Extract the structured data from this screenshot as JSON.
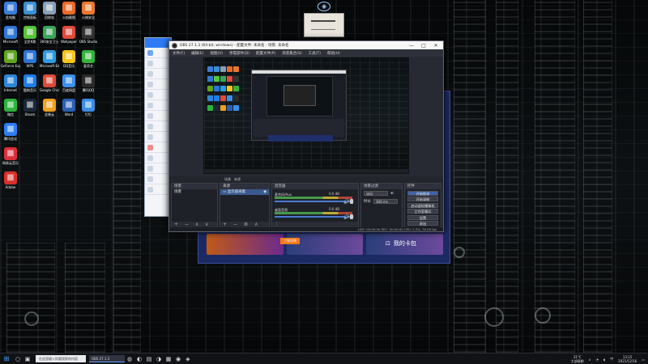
{
  "desktop": {
    "icons": [
      {
        "label": "此电脑",
        "icon": "pc-icon",
        "color": "#3b7dd8"
      },
      {
        "label": "控制面板",
        "icon": "control-panel-icon",
        "color": "#3a8fd4"
      },
      {
        "label": "回收站",
        "icon": "recycle-bin-icon",
        "color": "#8aa0b8"
      },
      {
        "label": "火焰截图",
        "icon": "flame-icon",
        "color": "#e86a2a"
      },
      {
        "label": "火绒安全",
        "icon": "shield-icon",
        "color": "#e9782e"
      },
      {
        "label": "Microsoft",
        "icon": "microsoft-icon",
        "color": "#2f78d6"
      },
      {
        "label": "全民K歌",
        "icon": "music-icon",
        "color": "#57c43b"
      },
      {
        "label": "360安全卫士",
        "icon": "security-icon",
        "color": "#3ba55c"
      },
      {
        "label": "Wallpaper",
        "icon": "wallpaper-icon",
        "color": "#e04a3a"
      },
      {
        "label": "OBS Studio",
        "icon": "obs-icon",
        "color": "#333333"
      },
      {
        "label": "GeForce Experience",
        "icon": "nvidia-icon",
        "color": "#62a51d"
      },
      {
        "label": "WPS",
        "icon": "wps-icon",
        "color": "#2c75d8"
      },
      {
        "label": "Microsoft Edge",
        "icon": "edge-icon",
        "color": "#2d9be0"
      },
      {
        "label": "QQ音乐",
        "icon": "qqmusic-icon",
        "color": "#f5c518"
      },
      {
        "label": "爱奇艺",
        "icon": "iqiyi-icon",
        "color": "#33b33d"
      },
      {
        "label": "Internet",
        "icon": "ie-icon",
        "color": "#2b86d6"
      },
      {
        "label": "酷狗音乐",
        "icon": "kugou-icon",
        "color": "#1d7de6"
      },
      {
        "label": "Google Chrome",
        "icon": "chrome-icon",
        "color": "#dd4a3a"
      },
      {
        "label": "百度网盘",
        "icon": "cloud-icon",
        "color": "#3a8fe8"
      },
      {
        "label": "腾讯QQ",
        "icon": "qq-icon",
        "color": "#2a2a2a"
      },
      {
        "label": "微信",
        "icon": "wechat-icon",
        "color": "#2cb43a"
      },
      {
        "label": "Steam",
        "icon": "steam-icon",
        "color": "#1b2838"
      },
      {
        "label": "坚果云",
        "icon": "nut-icon",
        "color": "#f0a020"
      },
      {
        "label": "Word",
        "icon": "word-icon",
        "color": "#2b5fb4"
      },
      {
        "label": "钉钉",
        "icon": "dingtalk-icon",
        "color": "#3a8ee6"
      },
      {
        "label": "腾讯会议",
        "icon": "meeting-icon",
        "color": "#2d7df0"
      },
      {
        "label": "网易云音乐",
        "icon": "netease-icon",
        "color": "#d9303a"
      },
      {
        "label": "Adobe",
        "icon": "adobe-icon",
        "color": "#d8302a"
      }
    ]
  },
  "obs": {
    "title": "OBS 27.1.3 (64-bit, windows) - 配置文件: 未命名 - 场景: 未命名",
    "window_buttons": [
      "—",
      "□",
      "✕"
    ],
    "menu": [
      "文件(F)",
      "编辑(E)",
      "视图(V)",
      "停靠部件(D)",
      "配置文件(P)",
      "场景集合(S)",
      "工具(T)",
      "帮助(H)"
    ],
    "tabs": [
      "场景",
      "来源"
    ],
    "scenes": {
      "title": "场景",
      "items": [
        "场景"
      ]
    },
    "sources": {
      "title": "来源",
      "items": [
        "显示器采集"
      ]
    },
    "mixer": {
      "title": "混音器",
      "channels": [
        {
          "name": "麦克风/Aux",
          "db": "0.0 dB"
        },
        {
          "name": "桌面音频",
          "db": "0.0 dB"
        }
      ]
    },
    "transitions": {
      "title": "场景过渡",
      "type": "淡出",
      "duration_label": "时长",
      "duration": "300 ms"
    },
    "controls": {
      "title": "控件",
      "buttons": [
        "开始推流",
        "开始录制",
        "启动虚拟摄像机",
        "工作室模式",
        "设置",
        "退出"
      ]
    },
    "status": "LIVE: 00:00:00   REC: 00:00:00   CPU: 2.3%, 30.00 fps"
  },
  "stream_app": {
    "cta": "了解详情",
    "widget_label": "我的卡包"
  },
  "taskbar": {
    "search_placeholder": "在这里输入你要搜索的内容",
    "task_label": "OBS 27.1.3",
    "temp": "31°C",
    "weather": "大部晴朗",
    "time": "13:15",
    "date": "2021/12/16"
  },
  "colors": {
    "obs_bg": "#272a33",
    "accent": "#3f63a6",
    "stream_bg": "#1c2a63",
    "taskbar": "#101216"
  }
}
